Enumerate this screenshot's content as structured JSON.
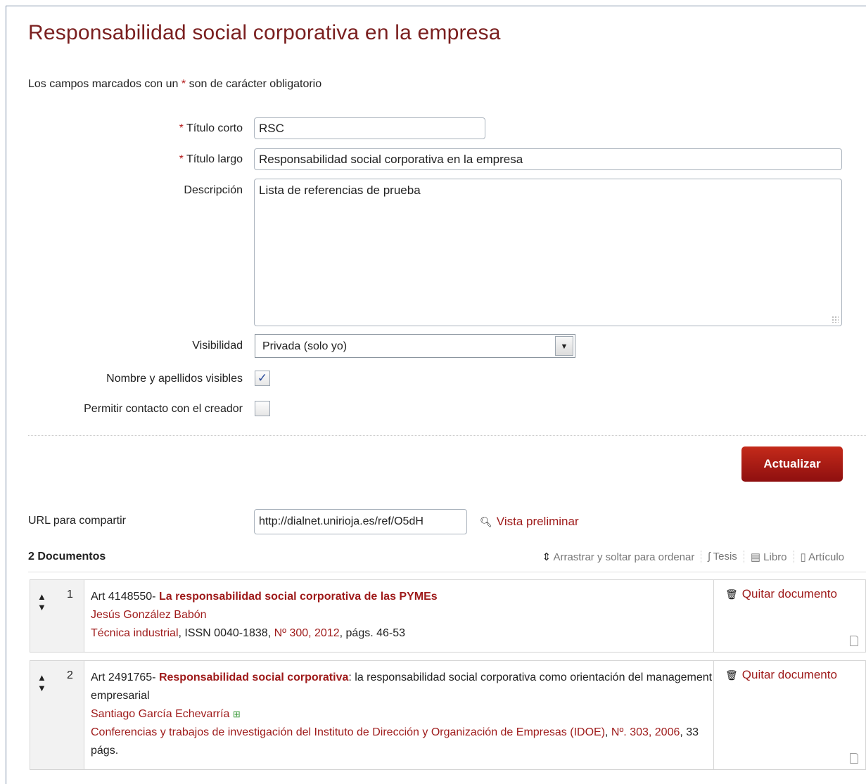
{
  "page_title": "Responsabilidad social corporativa en la empresa",
  "note": {
    "before": "Los campos marcados con un ",
    "star": "*",
    "after": " son de carácter obligatorio"
  },
  "form": {
    "titulo_corto": {
      "star": "*",
      "label": " Título corto",
      "value": "RSC"
    },
    "titulo_largo": {
      "star": "*",
      "label": " Título largo",
      "value": "Responsabilidad social corporativa en la empresa"
    },
    "descripcion": {
      "label": "Descripción",
      "value": "Lista de referencias de prueba"
    },
    "visibilidad": {
      "label": "Visibilidad",
      "selected": "Privada (solo yo)"
    },
    "nombre_visible": {
      "label": "Nombre y apellidos visibles",
      "checked": true,
      "mark": "✓"
    },
    "permitir_contacto": {
      "label": "Permitir contacto con el creador",
      "checked": false
    }
  },
  "update_button": "Actualizar",
  "share": {
    "label": "URL para compartir",
    "value": "http://dialnet.unirioja.es/ref/O5dH",
    "preview_label": "Vista preliminar"
  },
  "documents": {
    "count_label": "2 Documentos",
    "toolbar": {
      "sort": "Arrastrar y soltar para ordenar",
      "tesis": "Tesis",
      "libro": "Libro",
      "articulo": "Artículo"
    },
    "remove_label": "Quitar documento",
    "items": [
      {
        "num": "1",
        "ref": "Art 4148550- ",
        "title": "La responsabilidad social corporativa de las PYMEs",
        "author": "Jesús González Babón",
        "source_red": "Técnica industrial",
        "source_mid": ", ISSN 0040-1838, ",
        "issue": "Nº 300, 2012",
        "pages": ", págs. 46-53"
      },
      {
        "num": "2",
        "ref": "Art 2491765- ",
        "title": "Responsabilidad social corporativa",
        "subtitle": ": la responsabilidad social corporativa como orientación del management empresarial",
        "author": "Santiago García Echevarría",
        "author_icon": "group-icon",
        "source_red": "Conferencias y trabajos de investigación del Instituto de Dirección y Organización de Empresas (IDOE)",
        "source_mid": ", ",
        "issue": "Nº. 303, 2006",
        "pages": ", 33 págs."
      }
    ]
  }
}
